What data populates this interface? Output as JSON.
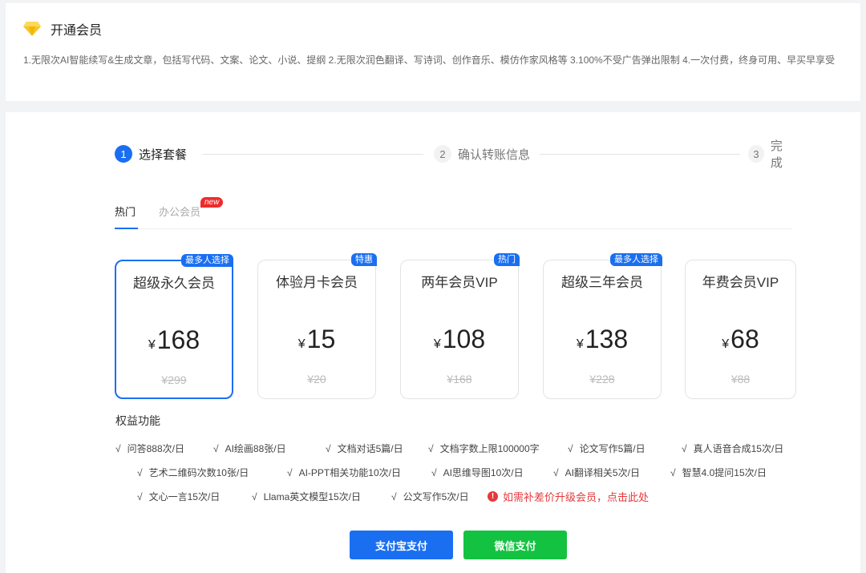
{
  "header": {
    "icon": "diamond-icon",
    "title": "开通会员",
    "description": "1.无限次AI智能续写&生成文章，包括写代码、文案、论文、小说、提纲   2.无限次润色翻译、写诗词、创作音乐、模仿作家风格等   3.100%不受广告弹出限制   4.一次付费，终身可用、早买早享受"
  },
  "steps": [
    {
      "num": "1",
      "label": "选择套餐",
      "active": true
    },
    {
      "num": "2",
      "label": "确认转账信息",
      "active": false
    },
    {
      "num": "3",
      "label": "完成",
      "active": false
    }
  ],
  "tabs": {
    "hot": "热门",
    "office": "办公会员",
    "new_badge": "new"
  },
  "plans": [
    {
      "name": "超级永久会员",
      "currency": "¥",
      "price": "168",
      "original": "¥299",
      "tag": "最多人选择",
      "selected": true
    },
    {
      "name": "体验月卡会员",
      "currency": "¥",
      "price": "15",
      "original": "¥20",
      "tag": "特惠",
      "selected": false
    },
    {
      "name": "两年会员VIP",
      "currency": "¥",
      "price": "108",
      "original": "¥168",
      "tag": "热门",
      "selected": false
    },
    {
      "name": "超级三年会员",
      "currency": "¥",
      "price": "138",
      "original": "¥228",
      "tag": "最多人选择",
      "selected": false
    },
    {
      "name": "年费会员VIP",
      "currency": "¥",
      "price": "68",
      "original": "¥88",
      "tag": "",
      "selected": false
    }
  ],
  "benefits": {
    "title": "权益功能",
    "check": "√",
    "rows": [
      [
        "问答888次/日",
        "AI绘画88张/日",
        "文档对话5篇/日",
        "文档字数上限100000字",
        "论文写作5篇/日",
        "真人语音合成15次/日"
      ],
      [
        "艺术二维码次数10张/日",
        "AI-PPT相关功能10次/日",
        "AI思维导图10次/日",
        "AI翻译相关5次/日",
        "智慧4.0提问15次/日"
      ],
      [
        "文心一言15次/日",
        "Llama英文模型15次/日",
        "公文写作5次/日"
      ]
    ],
    "upgrade_link": "如需补差价升级会员，点击此处",
    "warn_glyph": "!"
  },
  "payment": {
    "alipay": "支付宝支付",
    "wechat": "微信支付"
  },
  "colors": {
    "primary": "#1a6ff1",
    "wechat": "#14c241",
    "danger": "#e5393c",
    "badge_red": "#ee2b2b"
  }
}
